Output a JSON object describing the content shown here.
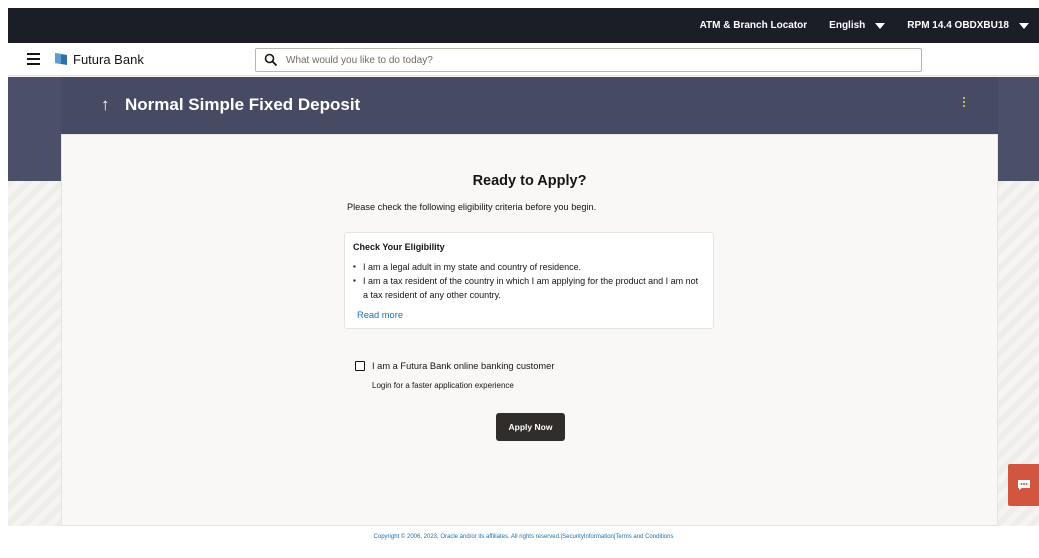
{
  "topbar": {
    "atm_locator": "ATM & Branch Locator",
    "language": "English",
    "user": "RPM 14.4 OBDXBU18"
  },
  "header": {
    "brand": "Futura Bank",
    "search_placeholder": "What would you like to do today?"
  },
  "banner": {
    "back_arrow": "↑",
    "title": "Normal Simple Fixed Deposit"
  },
  "main": {
    "heading": "Ready to Apply?",
    "description": "Please check the following eligibility criteria before you begin.",
    "eligibility": {
      "title": "Check Your Eligibility",
      "items": [
        "I am a legal adult in my state and country of residence.",
        "I am a tax resident of the country in which I am applying for the product and I am not a tax resident of any other country."
      ],
      "read_more": "Read more"
    },
    "customer_checkbox_label": "I am a Futura Bank online banking customer",
    "customer_checkbox_checked": false,
    "login_hint": "Login for a faster application experience",
    "apply_button": "Apply Now"
  },
  "footer": {
    "copyright": "Copyright © 2006, 2023, Oracle and/or its affiliates. All rights reserved.|SecurityInformation|Terms and Conditions"
  },
  "colors": {
    "topbar": "#1b1d27",
    "banner": "#474a63",
    "apply_button": "#312d2a",
    "link": "#1f6fad",
    "chat": "#d25540"
  },
  "icons": {
    "menu": "hamburger-icon",
    "logo": "futura-logo-icon",
    "search": "search-icon",
    "more": "kebab-icon",
    "chat": "chat-icon"
  }
}
